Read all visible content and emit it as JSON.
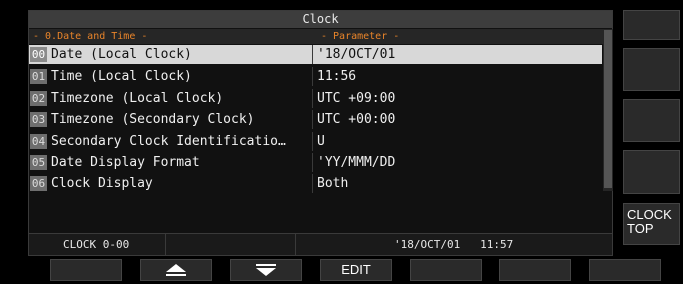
{
  "window": {
    "title": "Clock",
    "col_item_header": "- 0.Date and Time -",
    "col_param_header": "- Parameter -"
  },
  "rows": [
    {
      "num": "00",
      "label": "Date (Local Clock)",
      "value": "'18/OCT/01",
      "selected": true
    },
    {
      "num": "01",
      "label": "Time (Local Clock)",
      "value": "11:56"
    },
    {
      "num": "02",
      "label": "Timezone (Local Clock)",
      "value": "UTC +09:00"
    },
    {
      "num": "03",
      "label": "Timezone (Secondary Clock)",
      "value": "UTC +00:00"
    },
    {
      "num": "04",
      "label": "Secondary Clock Identificatio…",
      "value": "U"
    },
    {
      "num": "05",
      "label": "Date Display Format",
      "value": "'YY/MMM/DD"
    },
    {
      "num": "06",
      "label": "Clock Display",
      "value": "Both"
    }
  ],
  "status": {
    "menu_id": "CLOCK 0-00",
    "date_time": "'18/OCT/01   11:57"
  },
  "right_keys": [
    "",
    "",
    "",
    "",
    "CLOCK\nTOP"
  ],
  "bottom_keys": [
    {
      "label": "",
      "icon": ""
    },
    {
      "label": "",
      "icon": "up-triangle-icon"
    },
    {
      "label": "",
      "icon": "down-triangle-icon"
    },
    {
      "label": "EDIT",
      "icon": ""
    },
    {
      "label": "",
      "icon": ""
    },
    {
      "label": "",
      "icon": ""
    },
    {
      "label": "",
      "icon": ""
    }
  ]
}
